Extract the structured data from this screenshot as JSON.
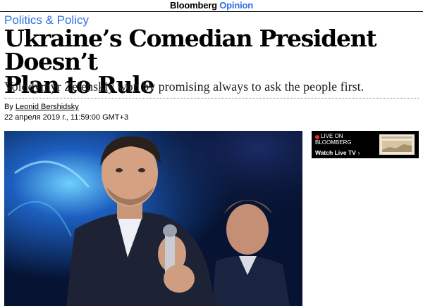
{
  "masthead": {
    "brand": "Bloomberg",
    "sub": "Opinion"
  },
  "article": {
    "section": "Politics & Policy",
    "headline_line1": "Ukraine’s Comedian President Doesn’t",
    "headline_line2": "Plan to Rule",
    "dek": "Volodymyr Zelenskiy won by promising always to ask the people first.",
    "byline_prefix": "By",
    "author": "Leonid Bershidsky",
    "date": "22 апреля 2019 г., 11:59:00 GMT+3"
  },
  "live_tv": {
    "line1": "LIVE ON",
    "line2": "BLOOMBERG",
    "watch_label": "Watch Live TV",
    "chevron": "›",
    "live_color": "#e6321e"
  },
  "colors": {
    "accent": "#2f6ee6",
    "live_bg": "#000000"
  }
}
